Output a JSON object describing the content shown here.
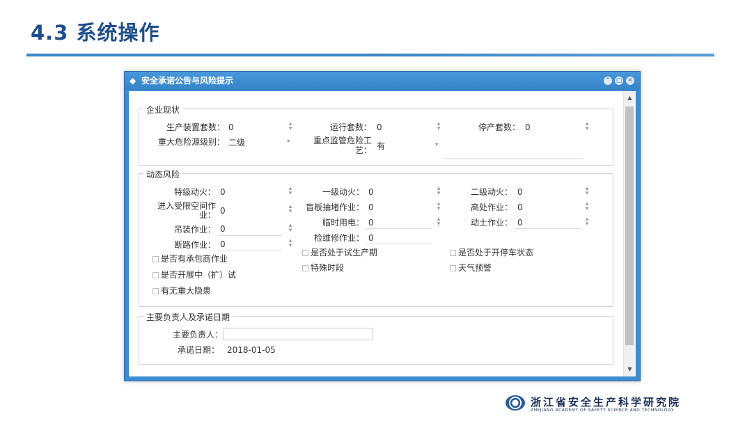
{
  "slide": {
    "title": "4.3 系统操作"
  },
  "dialog": {
    "title": "安全承诺公告与风险提示",
    "section_enterprise": {
      "legend": "企业现状",
      "fields": [
        {
          "label": "生产装置套数：",
          "value": "0"
        },
        {
          "label": "运行套数：",
          "value": "0"
        },
        {
          "label": "停产套数：",
          "value": "0"
        },
        {
          "label": "重大危险源级别：",
          "value": "二级"
        },
        {
          "label": "重点监管危险工",
          "label2": "艺：",
          "value": "有"
        }
      ]
    },
    "section_risk": {
      "legend": "动态风险",
      "fields": [
        {
          "label": "特级动火：",
          "value": "0"
        },
        {
          "label": "一级动火：",
          "value": "0"
        },
        {
          "label": "二级动火：",
          "value": "0"
        },
        {
          "label": "进入受限空间作",
          "label2": "业：",
          "value": "0"
        },
        {
          "label": "盲板抽堵作业：",
          "value": "0"
        },
        {
          "label": "高处作业：",
          "value": "0"
        },
        {
          "label": "吊装作业：",
          "value": "0"
        },
        {
          "label": "临时用电：",
          "value": "0"
        },
        {
          "label": "动土作业：",
          "value": "0"
        },
        {
          "label": "断路作业：",
          "value": "0"
        },
        {
          "label": "检维修作业：",
          "value": "0"
        }
      ],
      "checkboxes": [
        {
          "label": "是否处于试生产期"
        },
        {
          "label": "是否处于开停车状态"
        },
        {
          "label": "是否有承包商作业"
        },
        {
          "label": "特殊时段"
        },
        {
          "label": "天气预警"
        },
        {
          "label": "是否开展中（扩）试"
        },
        {
          "label": "有无重大隐患"
        }
      ]
    },
    "section_owner": {
      "legend": "主要负责人及承诺日期",
      "owner_label": "主要负责人：",
      "owner_value": "",
      "date_label": "承诺日期：",
      "date_value": "2018-01-05"
    }
  },
  "footer": {
    "org_cn": "浙江省安全生产科学研究院",
    "org_en": "ZHEJIANG ACADEMY OF SAFETY SCIENCE AND TECHNOLOGY"
  },
  "colors": {
    "title": "#1f4e8c",
    "dialog_header": "#3d8bd0",
    "rule": "#3d86c6"
  }
}
